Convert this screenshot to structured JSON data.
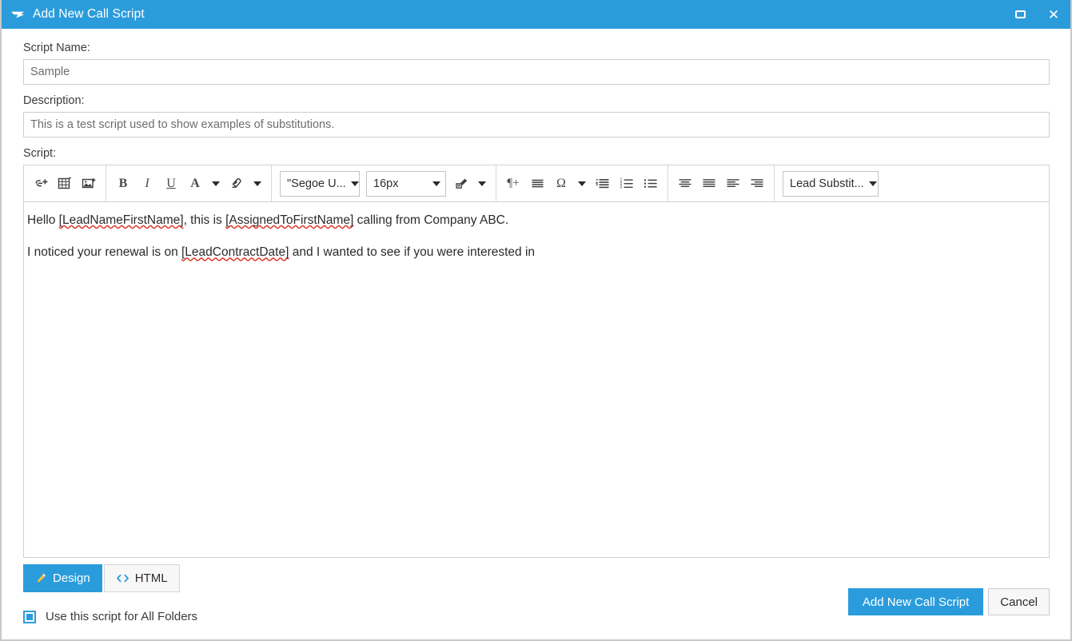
{
  "window": {
    "title": "Add New Call Script",
    "icon": "script-flag-icon",
    "accent_color": "#2b9cdb",
    "controls": {
      "restore_label": "",
      "close_label": "✕"
    }
  },
  "form": {
    "script_name": {
      "label": "Script Name:",
      "value": "Sample",
      "placeholder": "Script Name"
    },
    "description": {
      "label": "Description:",
      "value": "This is a test script used to show examples of substitutions.",
      "placeholder": "Description"
    },
    "script": {
      "label": "Script:"
    }
  },
  "toolbar": {
    "groups": [
      {
        "name": "insert",
        "items": [
          {
            "name": "insert-link-icon",
            "label": ""
          },
          {
            "name": "insert-table-icon",
            "label": ""
          },
          {
            "name": "insert-image-icon",
            "label": ""
          }
        ]
      },
      {
        "name": "formatting",
        "items": [
          {
            "name": "bold-button",
            "label": "B"
          },
          {
            "name": "italic-button",
            "label": "I"
          },
          {
            "name": "underline-button",
            "label": "U"
          },
          {
            "name": "font-color-button",
            "label": "A"
          },
          {
            "name": "font-color-caret",
            "label": ""
          },
          {
            "name": "highlight-color-icon",
            "label": ""
          },
          {
            "name": "highlight-color-caret",
            "label": ""
          }
        ]
      },
      {
        "name": "font",
        "font_family_value": "\"Segoe U...",
        "font_size_value": "16px",
        "format_painter": "format-painter-icon"
      },
      {
        "name": "paragraph",
        "items": [
          {
            "name": "insert-paragraph-icon",
            "label": "¶+"
          },
          {
            "name": "horizontal-rule-icon",
            "label": ""
          },
          {
            "name": "special-character-button",
            "label": "Ω"
          },
          {
            "name": "special-character-caret",
            "label": ""
          },
          {
            "name": "indent-icon",
            "label": ""
          },
          {
            "name": "numbered-list-icon",
            "label": ""
          },
          {
            "name": "bullet-list-icon",
            "label": ""
          }
        ]
      },
      {
        "name": "alignment",
        "items": [
          {
            "name": "align-center-icon",
            "label": ""
          },
          {
            "name": "align-justify-icon",
            "label": ""
          },
          {
            "name": "align-left-icon",
            "label": ""
          },
          {
            "name": "align-right-icon",
            "label": ""
          }
        ]
      },
      {
        "name": "substitutions",
        "dropdown_value": "Lead Substit..."
      }
    ]
  },
  "editor": {
    "line1_pre": "Hello ",
    "line1_token1": "[LeadNameFirstName]",
    "line1_mid": ", this is ",
    "line1_token2": "[AssignedToFirstName]",
    "line1_post": " calling from Company ABC.",
    "line2_pre": "I noticed your renewal is on ",
    "line2_token1": "[LeadContractDate]",
    "line2_post": " and I wanted to see if you were interested in"
  },
  "tabs": [
    {
      "name": "design-tab",
      "label": "Design",
      "icon": "pencil-icon",
      "active": true
    },
    {
      "name": "html-tab",
      "label": "HTML",
      "icon": "code-brackets-icon",
      "active": false
    }
  ],
  "options": {
    "all_folders_label": "Use this script for All Folders",
    "all_folders_checked": true
  },
  "footer": {
    "submit_label": "Add New Call Script",
    "cancel_label": "Cancel"
  }
}
